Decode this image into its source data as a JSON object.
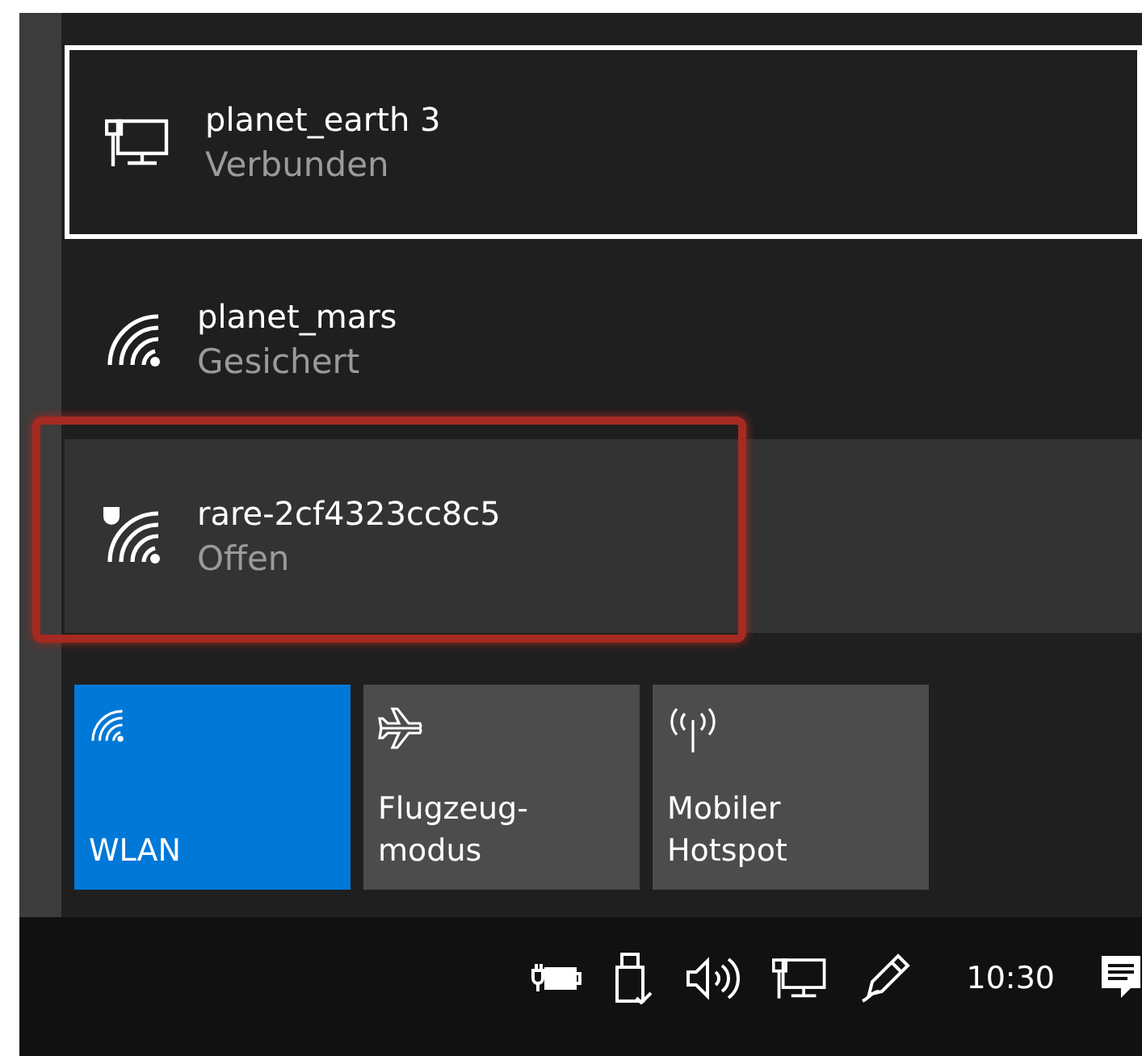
{
  "networks": [
    {
      "kind": "wired",
      "name": "planet_earth 3",
      "status": "Verbunden",
      "selected": true,
      "highlighted": false,
      "annotated": false
    },
    {
      "kind": "wifi",
      "name": "planet_mars",
      "status": "Gesichert",
      "selected": false,
      "highlighted": false,
      "annotated": false
    },
    {
      "kind": "wifi_open",
      "name": "rare-2cf4323cc8c5",
      "status": "Offen",
      "selected": false,
      "highlighted": true,
      "annotated": true
    }
  ],
  "quick_actions": [
    {
      "kind": "wlan",
      "label": "WLAN",
      "on": true
    },
    {
      "kind": "airplane",
      "label": "Flugzeug-\nmodus",
      "on": false
    },
    {
      "kind": "hotspot",
      "label": "Mobiler\nHotspot",
      "on": false
    }
  ],
  "taskbar": {
    "icons": [
      {
        "kind": "power"
      },
      {
        "kind": "usb"
      },
      {
        "kind": "volume"
      },
      {
        "kind": "network"
      },
      {
        "kind": "pen"
      }
    ],
    "time": "10:30"
  }
}
